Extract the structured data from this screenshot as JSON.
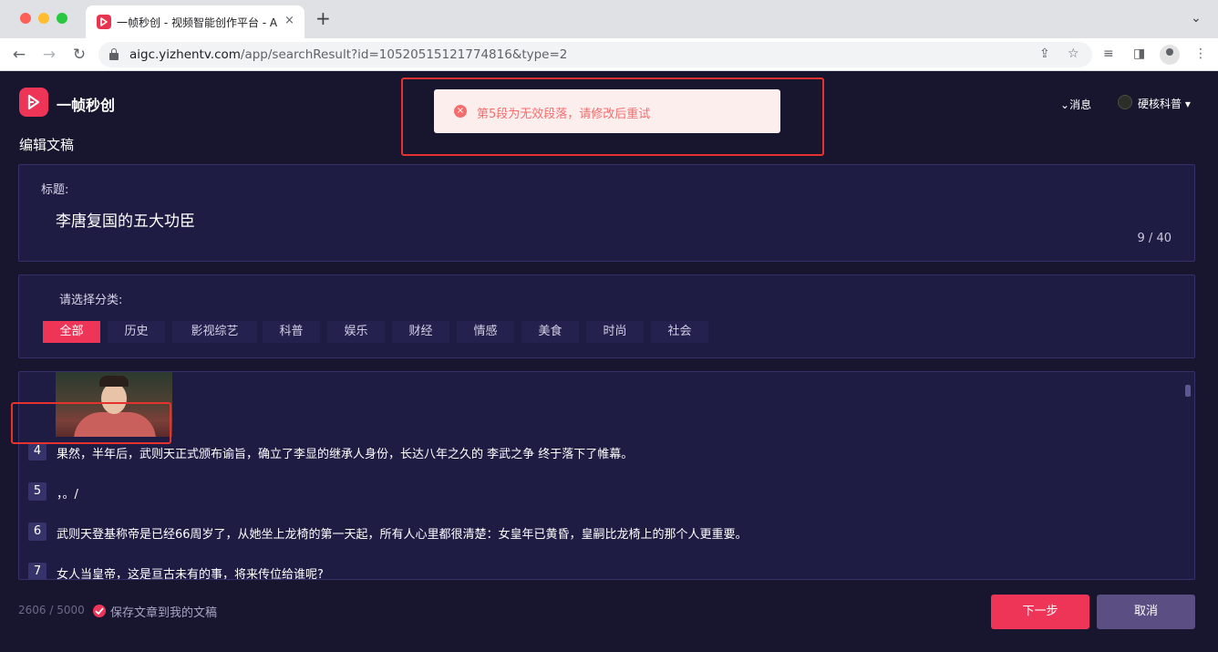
{
  "browser": {
    "tab_title": "一帧秒创 - 视频智能创作平台 - A",
    "tab_close": "×",
    "new_tab": "+",
    "url_host": "aigc.yizhentv.com",
    "url_path": "/app/searchResult?id=10520515121774816&type=2",
    "icons": [
      "back-arrow-icon",
      "forward-arrow-icon",
      "reload-icon",
      "lock-icon",
      "share-icon",
      "star-icon",
      "media-icon",
      "sidebar-icon",
      "profile-icon",
      "more-icon"
    ]
  },
  "app": {
    "logo_text": "一帧秒创",
    "page_title": "编辑文稿",
    "header": {
      "messages": "消息",
      "user": "硬核科普"
    },
    "title_section": {
      "label": "标题:",
      "value": "李唐复国的五大功臣",
      "counter": "9 / 40"
    },
    "category_section": {
      "label": "请选择分类:",
      "categories": [
        "全部",
        "历史",
        "影视综艺",
        "科普",
        "娱乐",
        "财经",
        "情感",
        "美食",
        "时尚",
        "社会"
      ],
      "selected": "全部"
    },
    "paragraphs": [
      {
        "num": "4",
        "text": "果然，半年后，武则天正式颁布谕旨，确立了李显的继承人身份，长达八年之久的 李武之争 终于落下了帷幕。"
      },
      {
        "num": "5",
        "text": "，。/"
      },
      {
        "num": "6",
        "text": "武则天登基称帝是已经66周岁了，从她坐上龙椅的第一天起，所有人心里都很清楚：女皇年已黄昏，皇嗣比龙椅上的那个人更重要。"
      },
      {
        "num": "7",
        "text": "女人当皇帝，这是亘古未有的事，将来传位给谁呢?"
      }
    ],
    "footer": {
      "word_count": "2606 / 5000",
      "save_label": "保存文章到我的文稿",
      "next_button": "下一步",
      "cancel_button": "取消"
    },
    "toast": {
      "message": "第5段为无效段落，请修改后重试"
    },
    "colors": {
      "accent": "#ee3557",
      "background": "#18152e",
      "panel": "#1f1c44",
      "error": "#f56c6c",
      "annotation_red": "#e4322e"
    }
  }
}
